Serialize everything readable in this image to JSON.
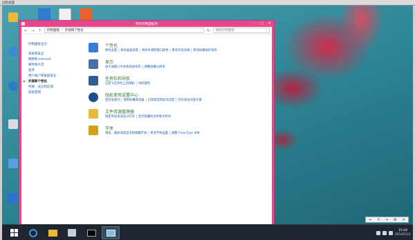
{
  "rdp": {
    "title": "远程桌面"
  },
  "window": {
    "title": "所有控制面板项",
    "controls": {
      "minimize": "–",
      "maximize": "□",
      "close": "✕"
    },
    "breadcrumb": [
      "控制面板",
      "外观和个性化"
    ],
    "search_placeholder": "搜索控制面板"
  },
  "left_nav": {
    "items": [
      "控制面板主页",
      "系统和安全",
      "网络和 Internet",
      "硬件和声音",
      "程序",
      "用户帐户和家庭安全",
      "外观和个性化",
      "时钟、语言和区域",
      "轻松使用"
    ],
    "selected_index": 6
  },
  "categories": [
    {
      "title": "个性化",
      "icon": "personalization-icon",
      "color": "#3a7bd5",
      "links": [
        "更改主题",
        "更改桌面背景",
        "更改半透明窗口颜色",
        "更改声音效果",
        "更改屏幕保护程序"
      ]
    },
    {
      "title": "显示",
      "icon": "display-icon",
      "color": "#4a6fa5",
      "links": [
        "放大或缩小文本和其他项目",
        "调整屏幕分辨率"
      ]
    },
    {
      "title": "任务栏和导航",
      "icon": "taskbar-icon",
      "color": "#2f5d8f",
      "links": [
        "自定义任务栏上的图标",
        "导航属性"
      ]
    },
    {
      "title": "轻松使用设置中心",
      "icon": "ease-of-access-icon",
      "color": "#1f4f8a",
      "links": [
        "适合低视力",
        "使用屏幕阅读器",
        "启用或禁用高对比度",
        "打开或关闭放大镜"
      ]
    },
    {
      "title": "文件资源管理器",
      "icon": "folder-icon",
      "color": "#e8b93a",
      "links": [
        "指定单击或双击以打开",
        "显示隐藏的文件和文件夹"
      ]
    },
    {
      "title": "字体",
      "icon": "font-icon",
      "color": "#d4a017",
      "links": [
        "预览、删除或者显示和隐藏字体",
        "更改字体设置",
        "调整 ClearType 文本"
      ]
    }
  ],
  "taskbar": {
    "clock_time": "15:44",
    "clock_date": "2014/5/21"
  },
  "rdp_toolbar": {
    "items": [
      "⇔",
      "✎",
      "⌖",
      "⊞",
      "✕"
    ]
  }
}
